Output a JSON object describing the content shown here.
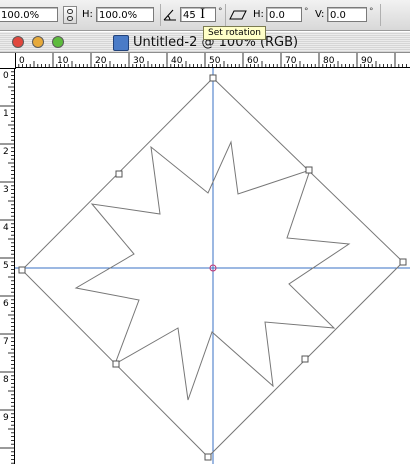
{
  "options_bar": {
    "width_value": "100.0%",
    "height_label": "H:",
    "height_value": "100.0%",
    "angle_value": "45",
    "degree_symbol": "°",
    "skew_h_label": "H:",
    "skew_h_value": "0.0",
    "skew_v_label": "V:",
    "skew_v_value": "0.0",
    "tooltip": "Set rotation"
  },
  "window": {
    "title": "Untitled-2 @ 100% (RGB)",
    "close_color": "#e0473d",
    "minimize_color": "#e6a93a",
    "zoom_color": "#5dbb3d"
  },
  "rulers": {
    "top_labels": [
      "0",
      "10",
      "20",
      "30",
      "40",
      "50",
      "60",
      "70",
      "80",
      "90"
    ],
    "left_labels": [
      "0",
      "1",
      "2",
      "3",
      "4",
      "5",
      "6",
      "7",
      "8",
      "9"
    ]
  },
  "canvas": {
    "guide_color": "#3a72c4",
    "shape_color": "#777777"
  }
}
